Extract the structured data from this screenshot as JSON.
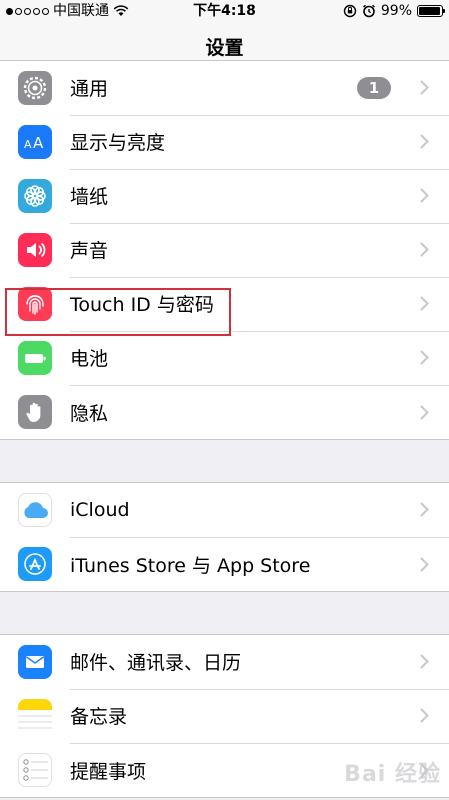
{
  "status": {
    "carrier": "中国联通",
    "time": "下午4:18",
    "battery_pct": "99%",
    "battery_level": 0.99
  },
  "nav": {
    "title": "设置"
  },
  "groups": [
    [
      {
        "label": "通用",
        "icon": "gear-icon",
        "badge": "1",
        "color": "#8e8e93"
      },
      {
        "label": "显示与亮度",
        "icon": "display-icon",
        "color": "#1a7af8"
      },
      {
        "label": "墙纸",
        "icon": "wallpaper-icon",
        "color": "#34aadc"
      },
      {
        "label": "声音",
        "icon": "sound-icon",
        "color": "#ff2d55"
      },
      {
        "label": "Touch ID 与密码",
        "icon": "fingerprint-icon",
        "color": "#ff3b56"
      },
      {
        "label": "电池",
        "icon": "battery-icon",
        "color": "#4cd964"
      },
      {
        "label": "隐私",
        "icon": "hand-icon",
        "color": "#8e8e93"
      }
    ],
    [
      {
        "label": "iCloud",
        "icon": "cloud-icon",
        "color": "#ffffff"
      },
      {
        "label": "iTunes Store 与 App Store",
        "icon": "appstore-icon",
        "color": "#1d9bf6"
      }
    ],
    [
      {
        "label": "邮件、通讯录、日历",
        "icon": "mail-icon",
        "color": "#1a82fb"
      },
      {
        "label": "备忘录",
        "icon": "notes-icon",
        "color": "#ffd60a"
      },
      {
        "label": "提醒事项",
        "icon": "reminders-icon",
        "color": "#ffffff"
      }
    ]
  ],
  "watermark": "Bai 经验"
}
